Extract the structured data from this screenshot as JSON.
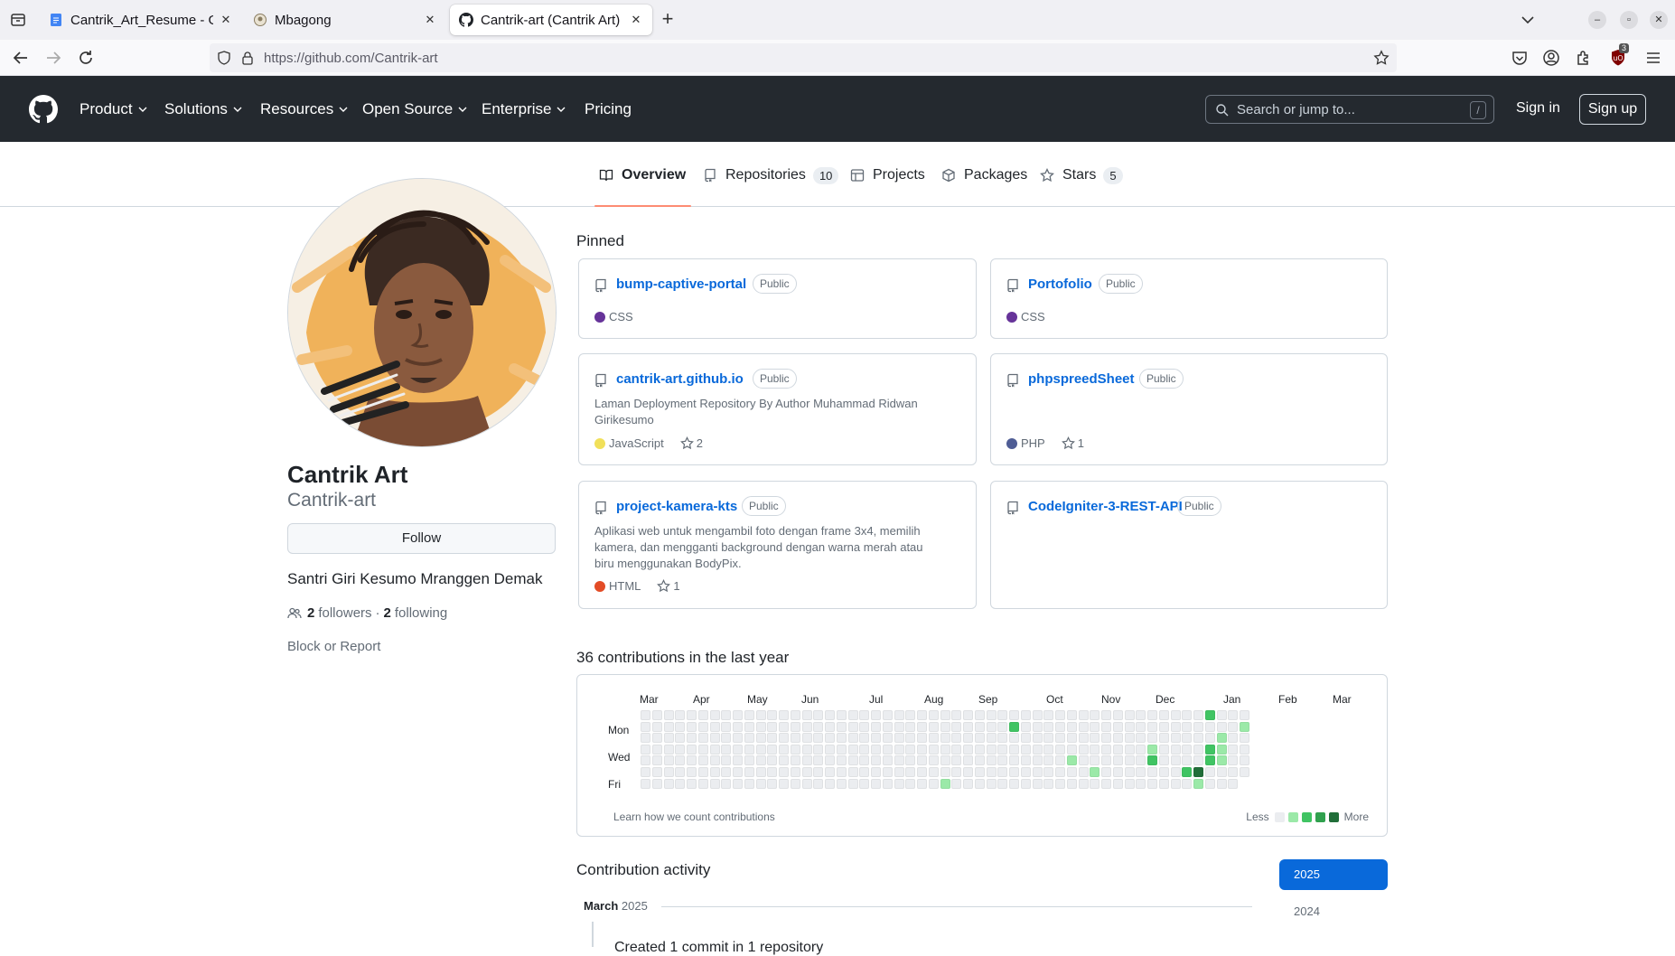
{
  "browser": {
    "tabs": [
      {
        "title": "Cantrik_Art_Resume - Go",
        "favicon": "google-docs-icon",
        "active": false
      },
      {
        "title": "Mbagong",
        "favicon": "mbagong-favicon",
        "active": false
      },
      {
        "title": "Cantrik-art (Cantrik Art) · G",
        "favicon": "github-icon",
        "active": true
      }
    ],
    "url": "https://github.com/Cantrik-art",
    "extension_badge": "3"
  },
  "header": {
    "nav": [
      "Product",
      "Solutions",
      "Resources",
      "Open Source",
      "Enterprise",
      "Pricing"
    ],
    "search_placeholder": "Search or jump to...",
    "search_hotkey": "/",
    "sign_in": "Sign in",
    "sign_up": "Sign up"
  },
  "profile_tabs": [
    {
      "label": "Overview",
      "count": null,
      "icon": "book-icon"
    },
    {
      "label": "Repositories",
      "count": "10",
      "icon": "repo-icon"
    },
    {
      "label": "Projects",
      "count": null,
      "icon": "table-icon"
    },
    {
      "label": "Packages",
      "count": null,
      "icon": "package-icon"
    },
    {
      "label": "Stars",
      "count": "5",
      "icon": "star-icon"
    }
  ],
  "profile": {
    "name": "Cantrik Art",
    "login": "Cantrik-art",
    "follow_label": "Follow",
    "bio": "Santri Giri Kesumo Mranggen Demak",
    "followers": "2",
    "followers_label": "followers",
    "separator": "·",
    "following": "2",
    "following_label": "following",
    "block": "Block or Report"
  },
  "pinned": {
    "heading": "Pinned",
    "cards": [
      {
        "name": "bump-captive-portal",
        "visibility": "Public",
        "description": "",
        "language": "CSS",
        "lang_color": "#663399",
        "stars": ""
      },
      {
        "name": "Portofolio",
        "visibility": "Public",
        "description": "",
        "language": "CSS",
        "lang_color": "#663399",
        "stars": ""
      },
      {
        "name": "cantrik-art.github.io",
        "visibility": "Public",
        "description": "Laman Deployment Repository By Author Muhammad Ridwan Girikesumo",
        "language": "JavaScript",
        "lang_color": "#f1e05a",
        "stars": "2"
      },
      {
        "name": "phpspreedSheet",
        "visibility": "Public",
        "description": "",
        "language": "PHP",
        "lang_color": "#4F5D95",
        "stars": "1"
      },
      {
        "name": "project-kamera-kts",
        "visibility": "Public",
        "description": "Aplikasi web untuk mengambil foto dengan frame 3x4, memilih kamera, dan mengganti background dengan warna merah atau biru menggunakan BodyPix.",
        "language": "HTML",
        "lang_color": "#e34c26",
        "stars": "1"
      },
      {
        "name": "CodeIgniter-3-REST-API",
        "visibility": "Public",
        "description": "",
        "language": "",
        "lang_color": "",
        "stars": ""
      }
    ]
  },
  "contributions": {
    "heading": "36 contributions in the last year",
    "months": [
      "Mar",
      "Apr",
      "May",
      "Jun",
      "Jul",
      "Aug",
      "Sep",
      "Oct",
      "Nov",
      "Dec",
      "Jan",
      "Feb",
      "Mar"
    ],
    "day_labels": [
      "Mon",
      "Wed",
      "Fri"
    ],
    "weeks": 53,
    "levels": [
      "#ebedf0",
      "#9be9a8",
      "#40c463",
      "#30a14e",
      "#216e39"
    ],
    "active_cells": [
      {
        "week": 32,
        "day": 1,
        "level": 2
      },
      {
        "week": 26,
        "day": 6,
        "level": 1
      },
      {
        "week": 37,
        "day": 4,
        "level": 1
      },
      {
        "week": 39,
        "day": 5,
        "level": 1
      },
      {
        "week": 44,
        "day": 3,
        "level": 1
      },
      {
        "week": 44,
        "day": 4,
        "level": 2
      },
      {
        "week": 47,
        "day": 5,
        "level": 2
      },
      {
        "week": 48,
        "day": 5,
        "level": 4
      },
      {
        "week": 48,
        "day": 6,
        "level": 1
      },
      {
        "week": 49,
        "day": 0,
        "level": 2
      },
      {
        "week": 49,
        "day": 3,
        "level": 2
      },
      {
        "week": 49,
        "day": 4,
        "level": 2
      },
      {
        "week": 50,
        "day": 2,
        "level": 1
      },
      {
        "week": 50,
        "day": 3,
        "level": 1
      },
      {
        "week": 50,
        "day": 4,
        "level": 1
      },
      {
        "week": 52,
        "day": 1,
        "level": 1
      }
    ],
    "learn": "Learn how we count contributions",
    "less": "Less",
    "more": "More"
  },
  "activity": {
    "heading": "Contribution activity",
    "years": [
      "2025",
      "2024"
    ],
    "month": "March",
    "month_year": "2025",
    "first_event": "Created 1 commit in 1 repository"
  }
}
